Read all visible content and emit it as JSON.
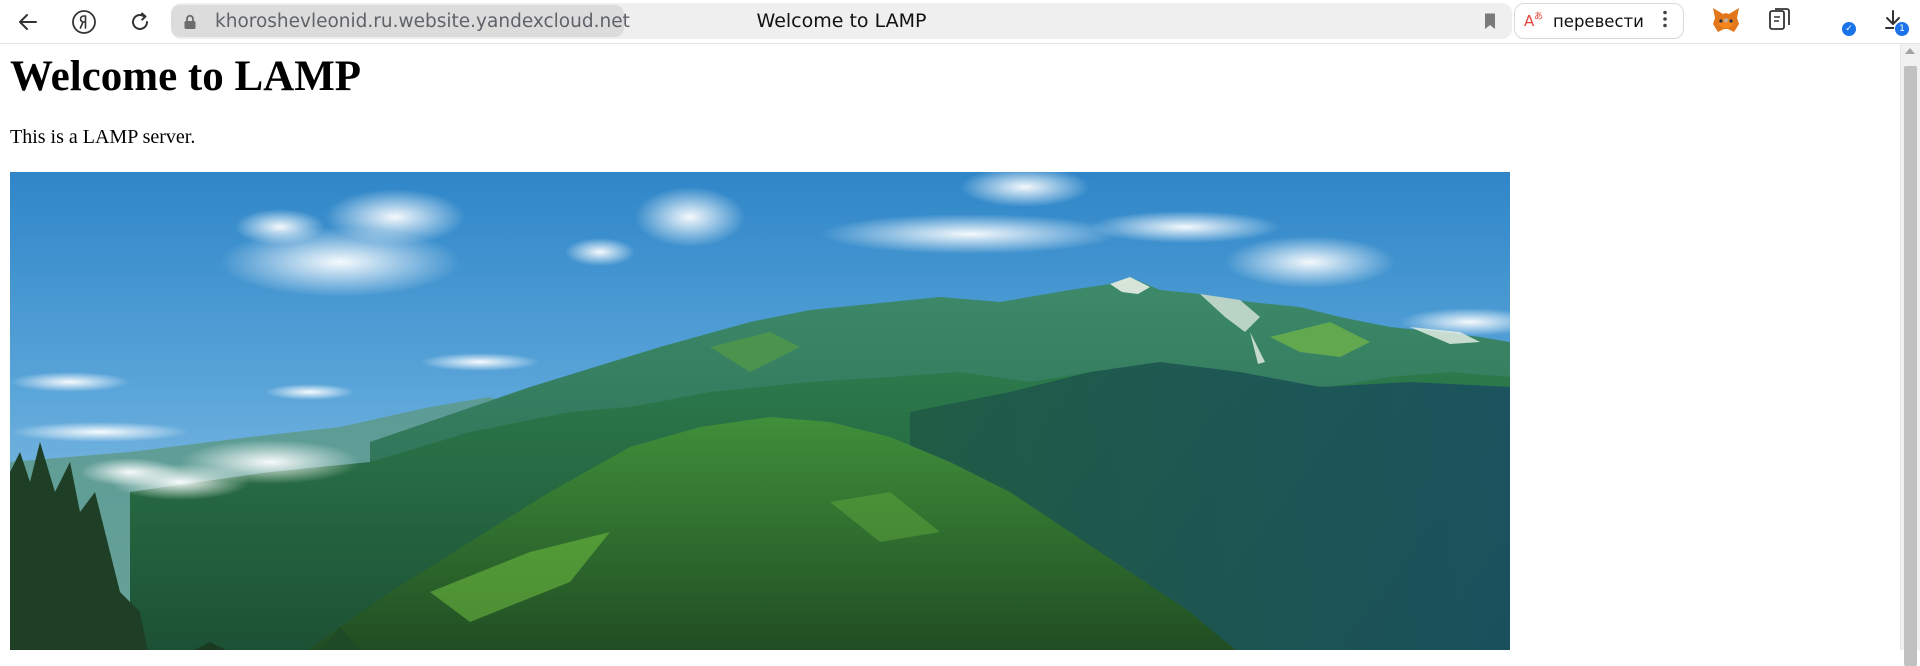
{
  "browser": {
    "url": "khoroshevleonid.ru.website.yandexcloud.net",
    "tab_title": "Welcome to LAMP",
    "nav": {
      "back_icon": "back-arrow-icon",
      "yandex_icon": "yandex-logo-icon",
      "reload_icon": "reload-icon"
    },
    "translate": {
      "label": "перевести",
      "icon": "translate-icon",
      "menu_icon": "more-vertical-icon"
    },
    "extensions": {
      "metamask_icon": "metamask-fox-icon",
      "collections_icon": "collections-icon",
      "profile_icon": "profile-icon",
      "downloads_icon": "download-icon",
      "downloads_count": "1"
    },
    "accent_color": "#1a73e8"
  },
  "page": {
    "heading": "Welcome to LAMP",
    "paragraph": "This is a LAMP server.",
    "image_subject": "mountain-landscape-image"
  }
}
